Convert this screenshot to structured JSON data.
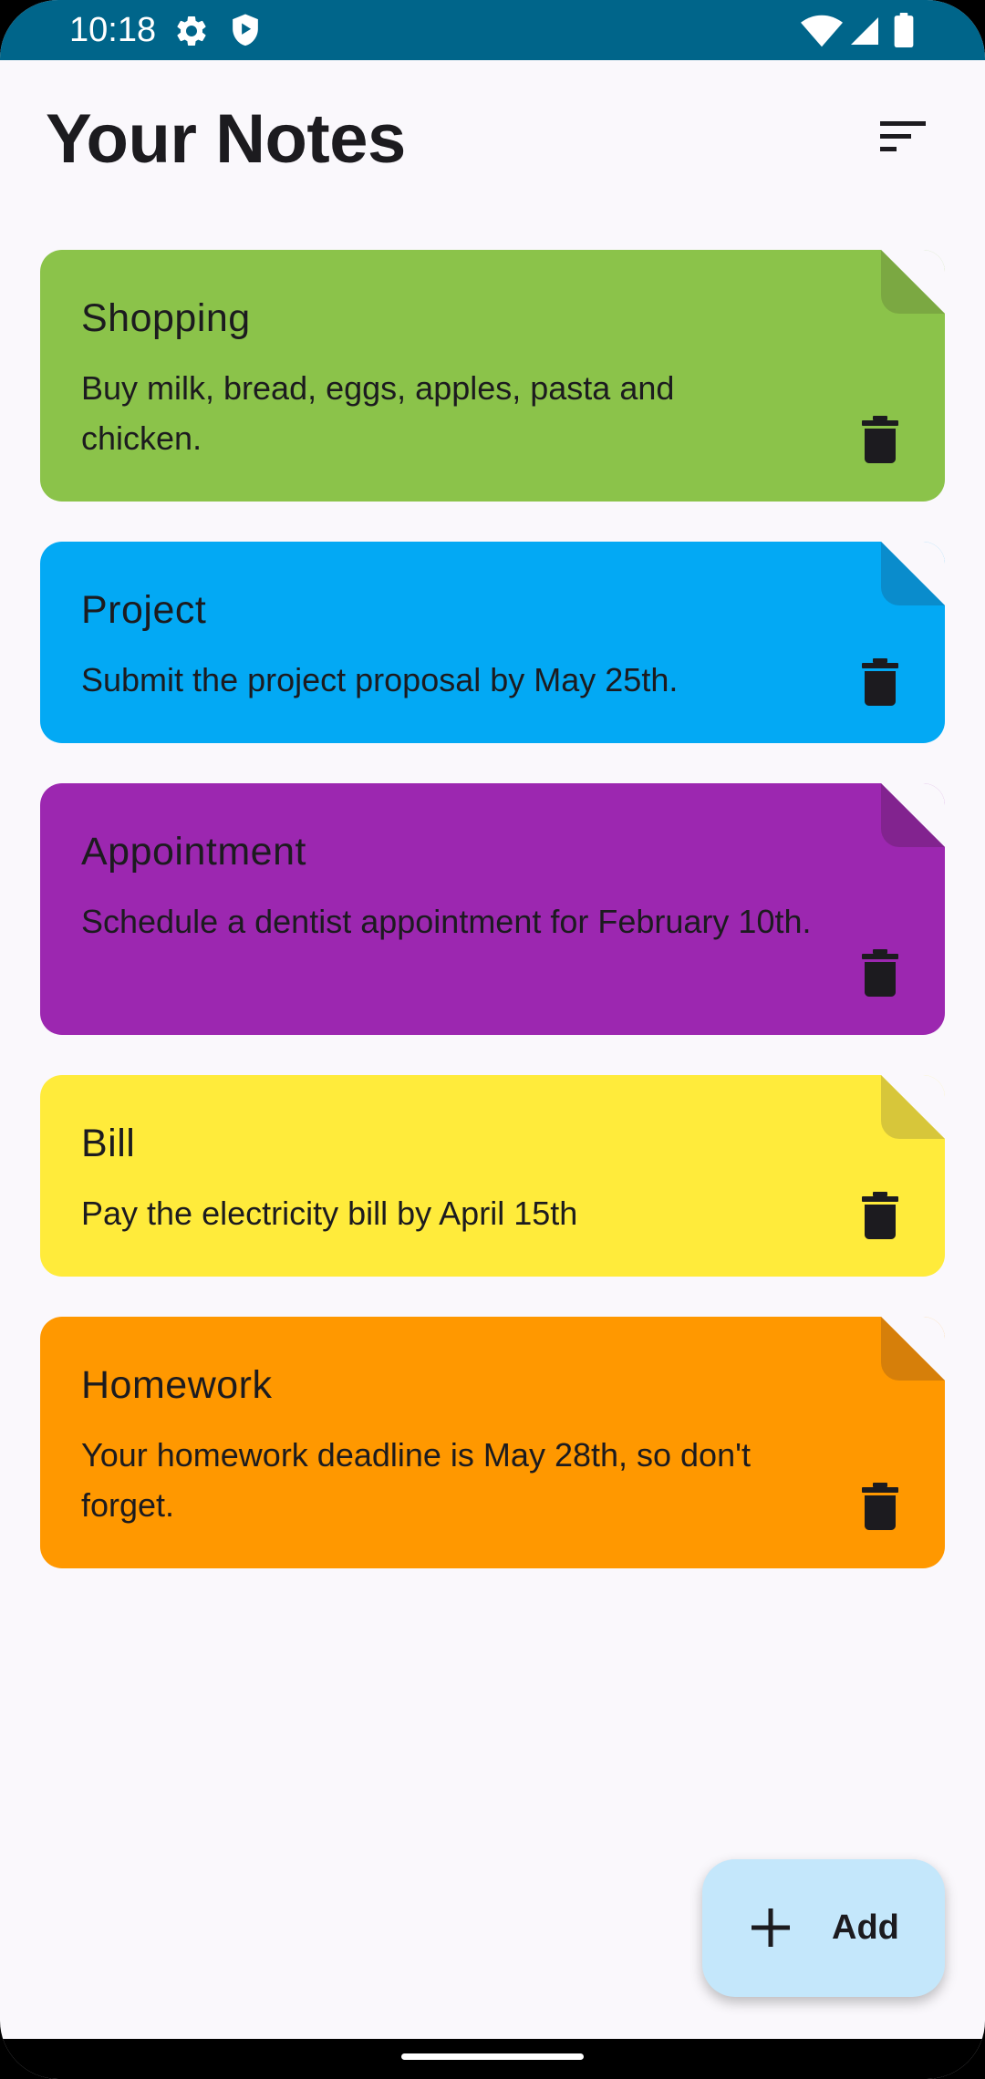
{
  "status_bar": {
    "time": "10:18",
    "icons": [
      "settings-gear-icon",
      "shield-play-icon",
      "wifi-icon",
      "cell-signal-icon",
      "battery-icon"
    ],
    "background_color": "#00658a"
  },
  "header": {
    "title": "Your Notes",
    "sort_icon": "sort-lines-icon"
  },
  "notes": [
    {
      "title": "Shopping",
      "content": "Buy milk, bread, eggs, apples, pasta and chicken.",
      "color": "#8bc34a",
      "fold_color": "#7ba842",
      "delete_icon": "trash-icon"
    },
    {
      "title": "Project",
      "content": "Submit the project proposal by May 25th.",
      "color": "#03a9f4",
      "fold_color": "#0a8ccc",
      "delete_icon": "trash-icon"
    },
    {
      "title": "Appointment",
      "content": "Schedule a dentist appointment for February 10th.",
      "color": "#9c27b0",
      "fold_color": "#82238f",
      "delete_icon": "trash-icon"
    },
    {
      "title": "Bill",
      "content": "Pay the electricity bill by April 15th",
      "color": "#ffeb3b",
      "fold_color": "#d7c63a",
      "delete_icon": "trash-icon"
    },
    {
      "title": "Homework",
      "content": "Your homework deadline is May 28th, so don't forget.",
      "color": "#ff9800",
      "fold_color": "#d67f0a",
      "delete_icon": "trash-icon"
    }
  ],
  "fab": {
    "label": "Add",
    "icon": "plus-icon",
    "background_color": "#c4e7fb"
  },
  "background_color": "#faf8fc"
}
